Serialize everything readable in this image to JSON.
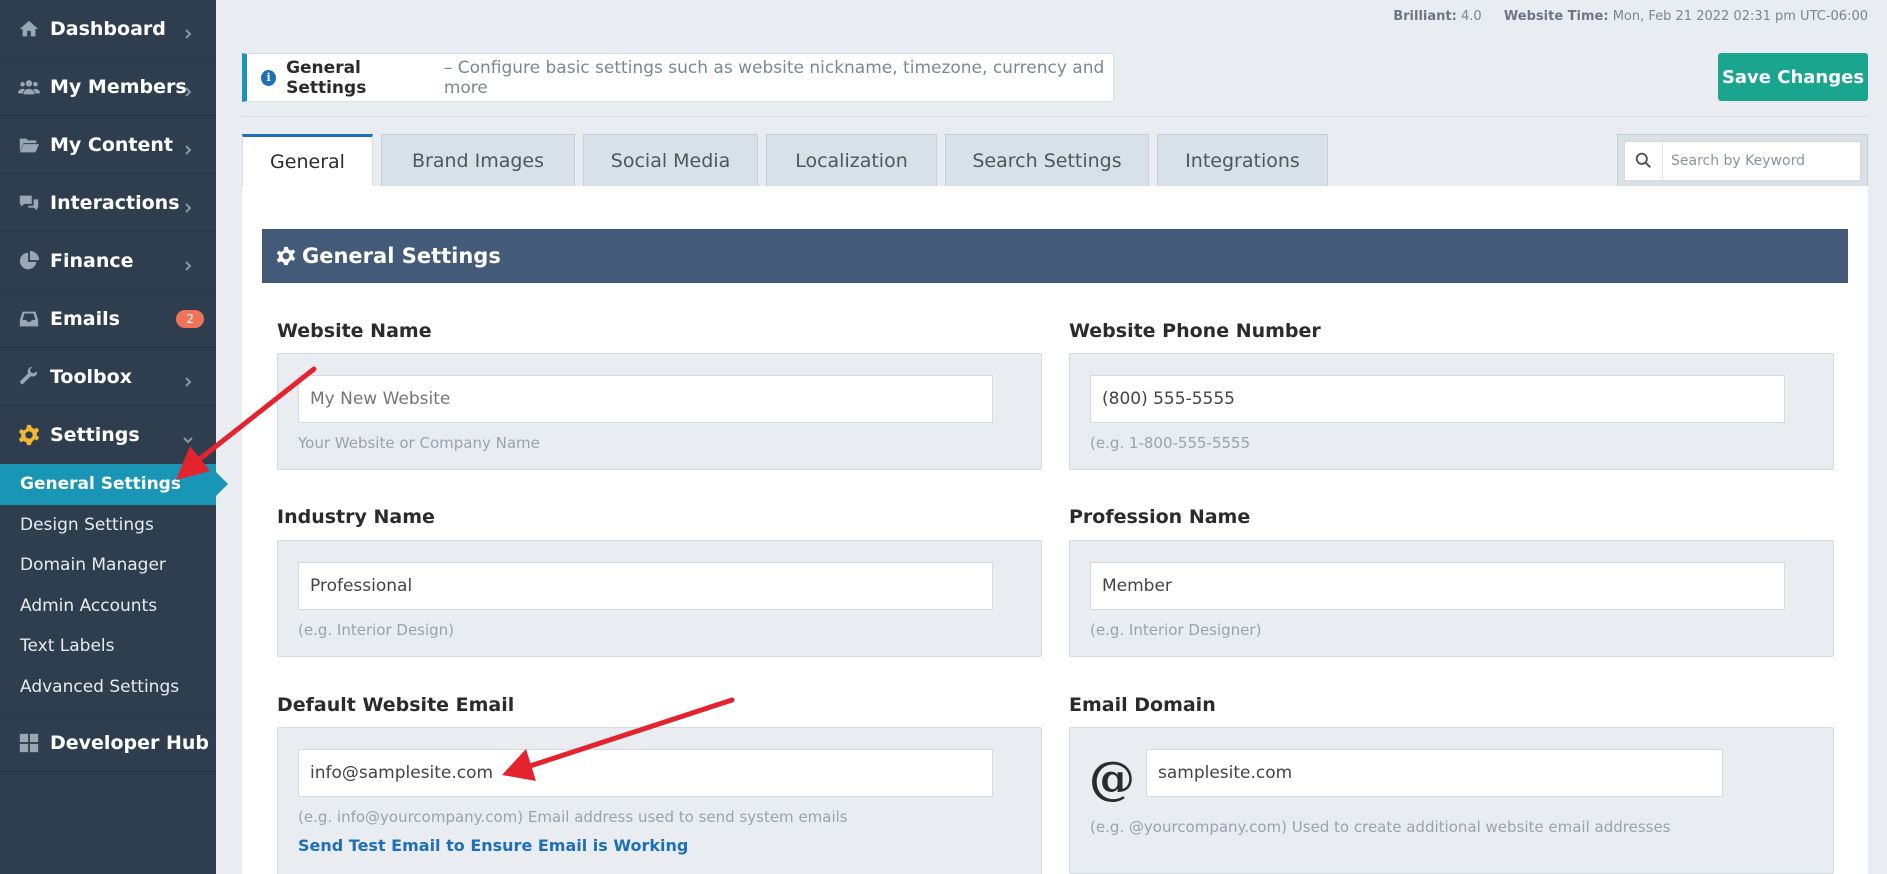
{
  "topbar": {
    "version_label": "Brilliant:",
    "version_value": "4.0",
    "time_label": "Website Time:",
    "time_value": "Mon, Feb 21 2022 02:31 pm UTC-06:00"
  },
  "sidebar": {
    "items": [
      {
        "label": "Dashboard",
        "icon": "home-icon"
      },
      {
        "label": "My Members",
        "icon": "users-icon"
      },
      {
        "label": "My Content",
        "icon": "folder-open-icon"
      },
      {
        "label": "Interactions",
        "icon": "comments-icon"
      },
      {
        "label": "Finance",
        "icon": "pie-chart-icon"
      },
      {
        "label": "Emails",
        "icon": "inbox-icon",
        "badge": "2"
      },
      {
        "label": "Toolbox",
        "icon": "wrench-icon"
      },
      {
        "label": "Settings",
        "icon": "gear-icon"
      }
    ],
    "settings_sub": [
      {
        "label": "General Settings",
        "active": true
      },
      {
        "label": "Design Settings"
      },
      {
        "label": "Domain Manager"
      },
      {
        "label": "Admin Accounts"
      },
      {
        "label": "Text Labels"
      },
      {
        "label": "Advanced Settings"
      }
    ],
    "developer_hub": {
      "label": "Developer Hub",
      "icon": "grid-icon"
    }
  },
  "info": {
    "title": "General Settings",
    "description": "– Configure basic settings such as website nickname, timezone, currency and more"
  },
  "save_button": "Save Changes",
  "tabs": [
    {
      "label": "General",
      "active": true
    },
    {
      "label": "Brand Images"
    },
    {
      "label": "Social Media"
    },
    {
      "label": "Localization"
    },
    {
      "label": "Search Settings"
    },
    {
      "label": "Integrations"
    }
  ],
  "search": {
    "placeholder": "Search by Keyword"
  },
  "section": {
    "title": "General Settings"
  },
  "fields": {
    "website_name": {
      "label": "Website Name",
      "placeholder": "My New Website",
      "hint": "Your Website or Company Name"
    },
    "website_phone": {
      "label": "Website Phone Number",
      "value": "(800) 555-5555",
      "hint": "(e.g. 1-800-555-5555"
    },
    "industry_name": {
      "label": "Industry Name",
      "value": "Professional",
      "hint": "(e.g. Interior Design)"
    },
    "profession_name": {
      "label": "Profession Name",
      "value": "Member",
      "hint": "(e.g. Interior Designer)"
    },
    "default_email": {
      "label": "Default Website Email",
      "value": "info@samplesite.com",
      "hint": "(e.g. info@yourcompany.com) Email address used to send system emails",
      "link": "Send Test Email to Ensure Email is Working"
    },
    "email_domain": {
      "label": "Email Domain",
      "at": "@",
      "value": "samplesite.com",
      "hint": "(e.g. @yourcompany.com) Used to create additional website email addresses"
    }
  },
  "colors": {
    "sidebar_bg": "#2f3e4e",
    "active_blue": "#1995b6",
    "save_green": "#1aa58f",
    "section_header": "#435b78",
    "arrow_red": "#e3232d"
  }
}
